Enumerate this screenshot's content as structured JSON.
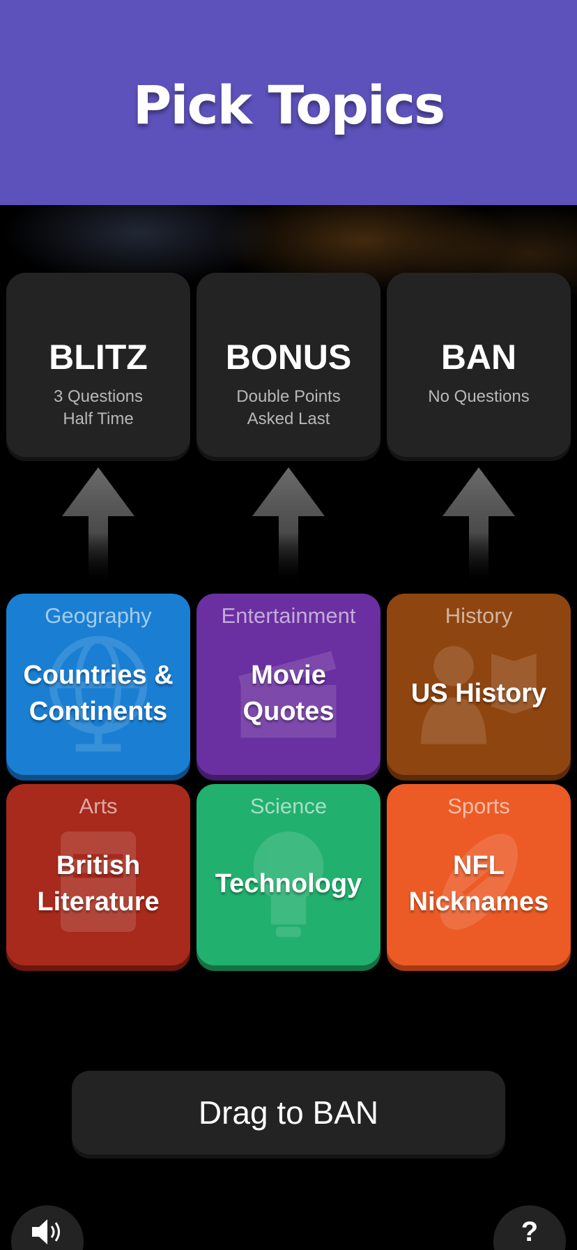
{
  "header": {
    "title": "Pick Topics",
    "background": "#5d52bb"
  },
  "slots": [
    {
      "title": "BLITZ",
      "line1": "3 Questions",
      "line2": "Half Time"
    },
    {
      "title": "BONUS",
      "line1": "Double Points",
      "line2": "Asked Last"
    },
    {
      "title": "BAN",
      "line1": "No Questions",
      "line2": ""
    }
  ],
  "topics": [
    {
      "category": "Geography",
      "name": "Countries &\nContinents",
      "color": "#1a7fd3",
      "icon": "globe-icon"
    },
    {
      "category": "Entertainment",
      "name": "Movie\nQuotes",
      "color": "#6a2fa0",
      "icon": "clapperboard-icon"
    },
    {
      "category": "History",
      "name": "US History",
      "color": "#8f4510",
      "icon": "person-book-icon"
    },
    {
      "category": "Arts",
      "name": "British\nLiterature",
      "color": "#a82a1c",
      "icon": "book-icon"
    },
    {
      "category": "Science",
      "name": "Technology",
      "color": "#22b06e",
      "icon": "lightbulb-icon"
    },
    {
      "category": "Sports",
      "name": "NFL\nNicknames",
      "color": "#ec5b26",
      "icon": "football-icon"
    }
  ],
  "drag_button": {
    "label": "Drag to BAN"
  },
  "controls": {
    "sound_icon": "speaker-icon",
    "help_label": "?"
  }
}
